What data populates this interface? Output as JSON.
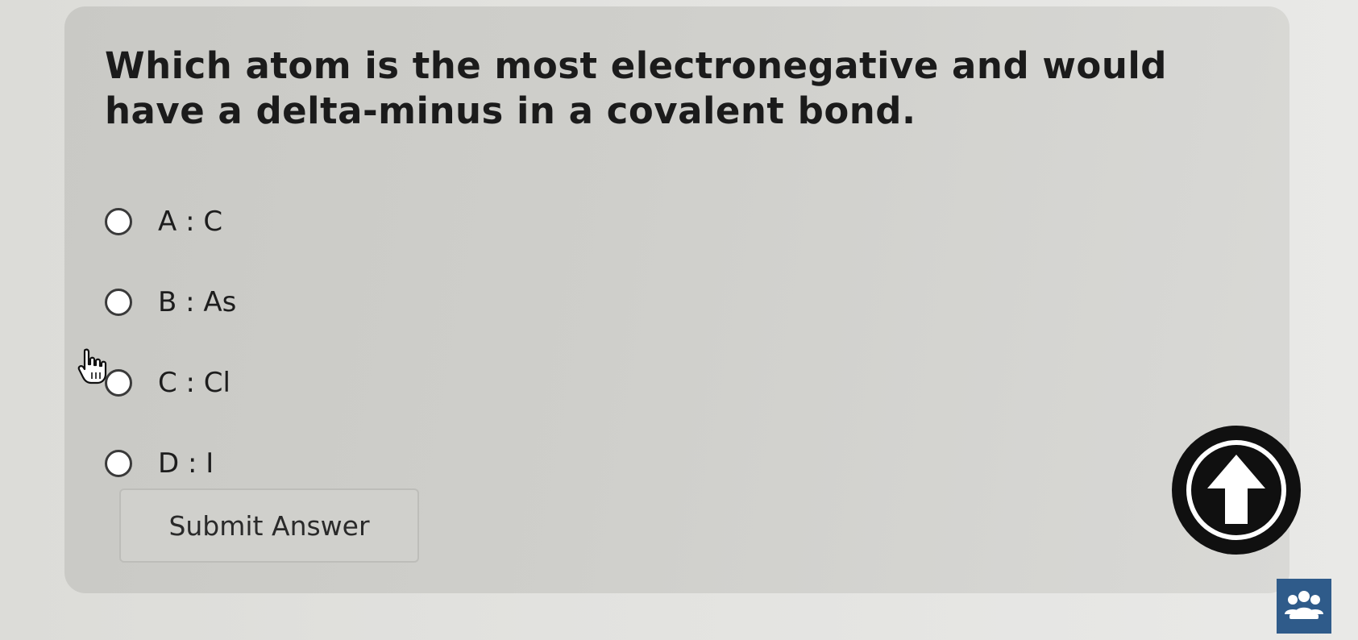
{
  "question": {
    "text": "Which atom is the most electronegative and would have a delta-minus in a covalent bond."
  },
  "options": [
    {
      "label": "A : C",
      "selected": false
    },
    {
      "label": "B : As",
      "selected": false
    },
    {
      "label": "C : Cl",
      "selected": false
    },
    {
      "label": "D : I",
      "selected": false
    }
  ],
  "submit": {
    "label": "Submit Answer"
  },
  "icons": {
    "scroll_top": "arrow-up-icon",
    "help": "group-people-icon",
    "cursor": "hand-pointer-icon"
  },
  "colors": {
    "card_background": "#cfcfcb",
    "scroll_top_button": "#101010",
    "help_button": "#2f5b8a"
  }
}
